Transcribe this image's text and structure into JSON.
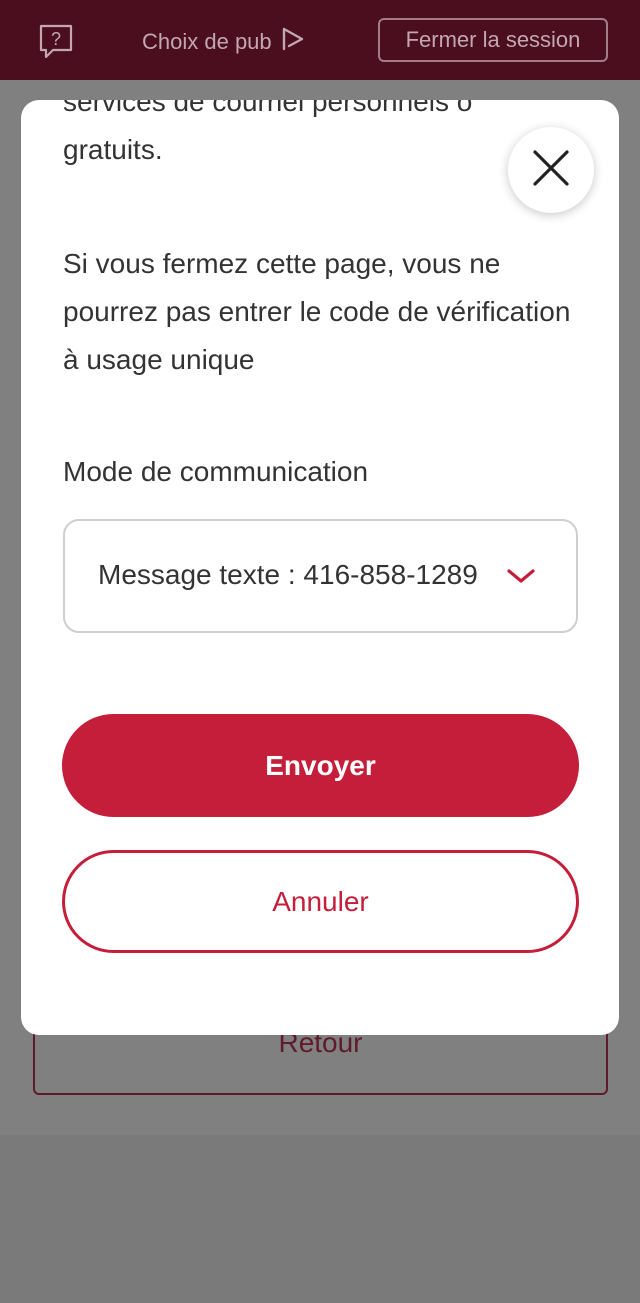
{
  "header": {
    "help_icon": "help-speech-bubble-icon",
    "adchoice_label": "Choix de pub",
    "adchoice_icon": "adchoices-play-icon",
    "logout_label": "Fermer la session"
  },
  "background_page": {
    "back_label": "Retour"
  },
  "modal": {
    "clipped_text": "services de courriel personnels o",
    "text_gratuits": "gratuits.",
    "warning_text": "Si vous fermez cette page, vous ne pourrez pas entrer le code de vérification à usage unique",
    "close_icon": "close-icon",
    "field_label": "Mode de communication",
    "selected_value": "Message texte : 416-858-1289",
    "chevron_icon": "chevron-down-icon",
    "send_label": "Envoyer",
    "cancel_label": "Annuler"
  },
  "colors": {
    "header_bg": "#4a0e1f",
    "overlay": "#808080",
    "accent_red": "#c41e3a",
    "text": "#333333"
  }
}
